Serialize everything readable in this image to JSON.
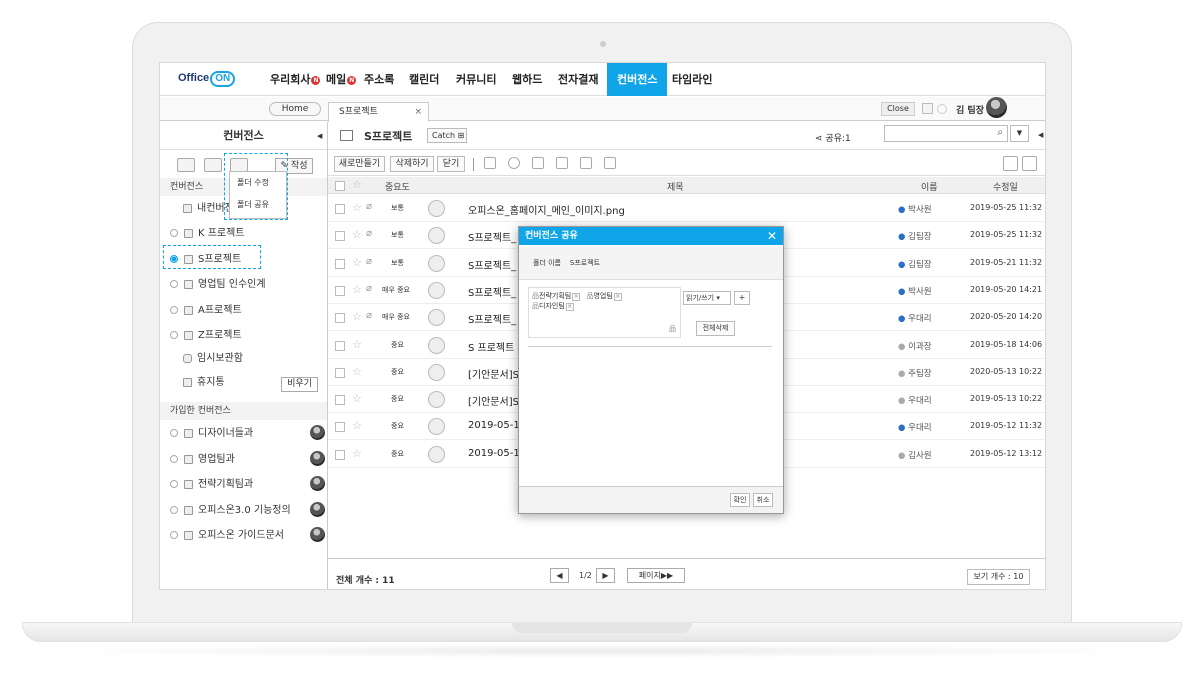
{
  "nav": {
    "logo": "Office",
    "logo_on": "ON",
    "items": [
      "우리회사",
      "메일",
      "주소록",
      "캘린더",
      "커뮤니티",
      "웹하드",
      "전자결재",
      "컨버전스",
      "타임라인"
    ],
    "badge": "N"
  },
  "tabbar": {
    "home": "Home",
    "tab": "S프로젝트",
    "tab_close": "×",
    "close": "Close",
    "user": "김 팀장"
  },
  "sidebar": {
    "title": "컨버전스",
    "write": "작성",
    "section1": "컨버전스",
    "items": [
      "내컨버전스",
      "K 프로젝트",
      "S프로젝트",
      "영업팀 인수인계",
      "A프로젝트",
      "Z프로젝트",
      "임시보관함",
      "휴지통"
    ],
    "empty": "비우기",
    "section2": "가입한 컨버전스",
    "joined": [
      "디자이너들과",
      "영업팀과",
      "전략기획팀과",
      "오피스온3.0 기능정의",
      "오피스온 가이드문서"
    ],
    "context_menu": [
      "폴더 수정",
      "폴더 공유"
    ]
  },
  "main": {
    "title": "S프로젝트",
    "catch": "Catch",
    "share": "공유:1",
    "buttons": [
      "새로만들기",
      "삭제하기",
      "닫기"
    ],
    "headers": {
      "importance": "중요도",
      "subject": "제목",
      "name": "이름",
      "date": "수정일"
    },
    "rows": [
      {
        "imp": "보통",
        "subject": "오피스온_홈페이지_메인_이미지.png",
        "name": "박사원",
        "date": "2019-05-25 11:32",
        "clip": true,
        "active": true
      },
      {
        "imp": "보통",
        "subject": "S프로젝트_",
        "name": "김팀장",
        "date": "2019-05-25 11:32",
        "clip": true,
        "active": true
      },
      {
        "imp": "보통",
        "subject": "S프로젝트_",
        "name": "김팀장",
        "date": "2019-05-21 11:32",
        "clip": true,
        "active": true
      },
      {
        "imp": "매우 중요",
        "subject": "S프로젝트_",
        "name": "박사원",
        "date": "2019-05-20 14:21",
        "clip": true,
        "active": true
      },
      {
        "imp": "매우 중요",
        "subject": "S프로젝트_",
        "name": "우대리",
        "date": "2020-05-20 14:20",
        "clip": true,
        "active": true
      },
      {
        "imp": "중요",
        "subject": "S 프로젝트",
        "name": "이과장",
        "date": "2019-05-18 14:06",
        "clip": false,
        "active": false
      },
      {
        "imp": "중요",
        "subject": "[기안문서]S",
        "name": "주팀장",
        "date": "2020-05-13 10:22",
        "clip": false,
        "active": false
      },
      {
        "imp": "중요",
        "subject": "[기안문서]S",
        "name": "우대리",
        "date": "2019-05-13 10:22",
        "clip": false,
        "active": false
      },
      {
        "imp": "중요",
        "subject": "2019-05-13",
        "name": "우대리",
        "date": "2019-05-12 11:32",
        "clip": false,
        "active": true
      },
      {
        "imp": "중요",
        "subject": "2019-05-12",
        "name": "김사원",
        "date": "2019-05-12 13:12",
        "clip": false,
        "active": false
      }
    ],
    "total": "전체 개수 : 11",
    "page": "1/2",
    "page_next": "페이지▶▶",
    "view_count": "보기 개수 : 10"
  },
  "dialog": {
    "title": "컨버전스 공유",
    "folder_label": "폴더 이름",
    "folder_name": "S프로젝트",
    "tags": [
      "전략기획팀",
      "영업팀",
      "디자인팀"
    ],
    "permission": "읽기/쓰기",
    "plus": "+",
    "delete_all": "전체삭제",
    "ok": "확인",
    "cancel": "취소"
  }
}
